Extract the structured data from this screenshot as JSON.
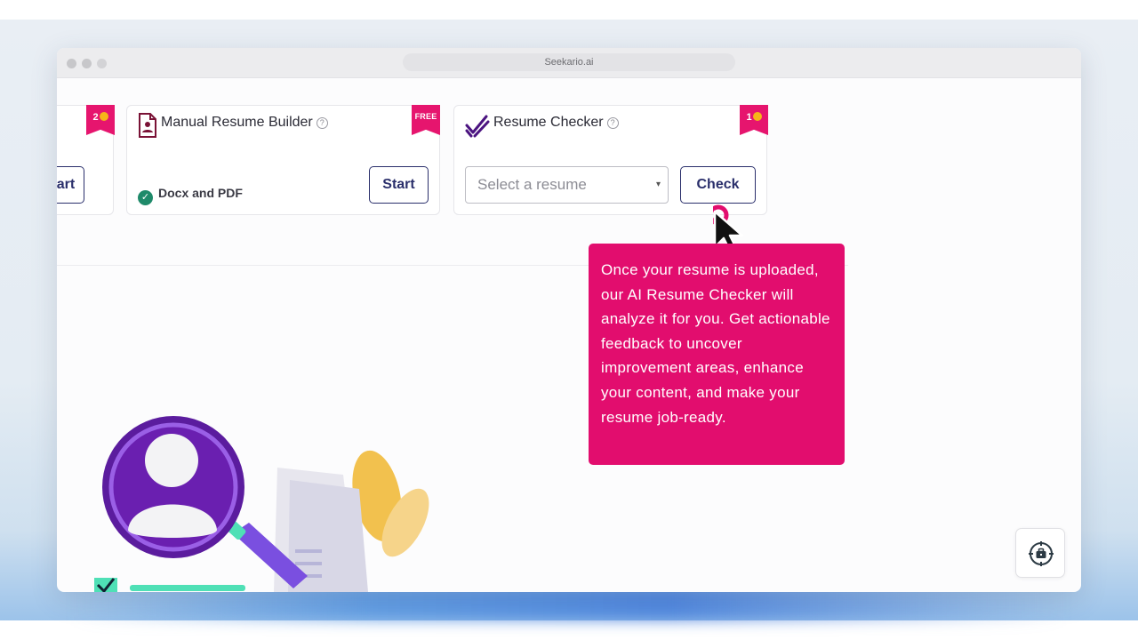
{
  "window": {
    "url": "Seekario.ai"
  },
  "cards": {
    "partial": {
      "badge": "2",
      "start_label": "Start"
    },
    "manual": {
      "title": "Manual Resume Builder",
      "badge": "FREE",
      "format": "Docx and PDF",
      "start_label": "Start"
    },
    "checker": {
      "title": "Resume Checker",
      "badge": "1",
      "select_placeholder": "Select a resume",
      "check_label": "Check"
    }
  },
  "tooltip": {
    "text": "Once your resume is uploaded, our AI Resume Checker will analyze it for you. Get actionable feedback to uncover improvement areas, enhance your content, and make your resume job-ready."
  },
  "colors": {
    "accent_pink": "#e20d6e",
    "button_navy": "#2a2f6b",
    "coin_gold": "#f6b619",
    "success_green": "#1f8a6a",
    "illustration_purple": "#6b1fa8"
  },
  "icons": [
    "document-icon",
    "double-check-icon",
    "help-icon",
    "check-circle-icon",
    "chevron-down-icon",
    "cursor-icon",
    "briefcase-help-icon"
  ]
}
